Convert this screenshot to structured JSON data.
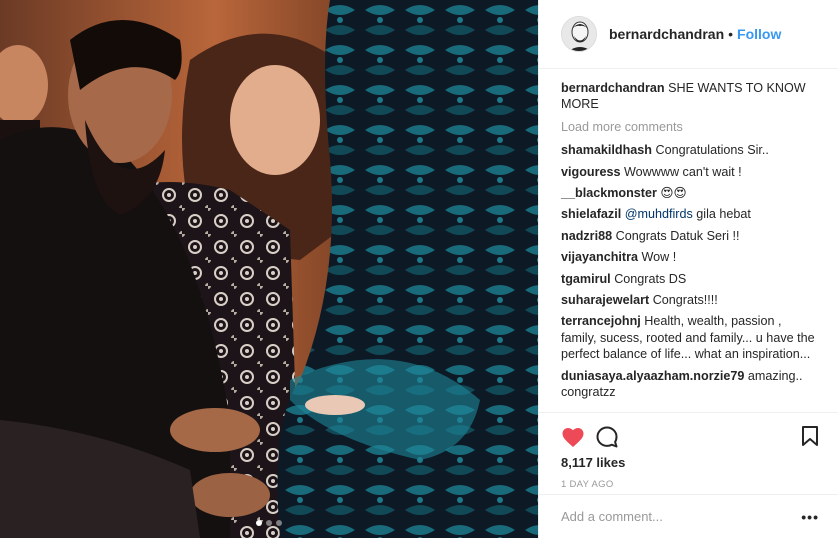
{
  "post": {
    "photo_label": "photo",
    "carousel": {
      "total": 3,
      "active": 0
    }
  },
  "header": {
    "username": "bernardchandran",
    "separator": "•",
    "follow_label": "Follow"
  },
  "caption": {
    "username": "bernardchandran",
    "text": "SHE WANTS TO KNOW MORE"
  },
  "load_more": "Load more comments",
  "comments": [
    {
      "username": "shamakildhash",
      "text": "Congratulations Sir.."
    },
    {
      "username": "vigouress",
      "text": "Wowwww can't wait !"
    },
    {
      "username": "__blackmonster",
      "text": "😍😍"
    },
    {
      "username": "shielafazil",
      "mention": "@muhdfirds",
      "text": "gila hebat"
    },
    {
      "username": "nadzri88",
      "text": "Congrats Datuk Seri !!"
    },
    {
      "username": "vijayanchitra",
      "text": "Wow !"
    },
    {
      "username": "tgamirul",
      "text": "Congrats DS"
    },
    {
      "username": "suharajewelart",
      "text": "Congrats!!!!"
    },
    {
      "username": "terrancejohnj",
      "text": "Health, wealth, passion , family, sucess, rooted and family... u have the perfect balance of life... what an inspiration..."
    },
    {
      "username": "duniasaya.alyaazham.norzie79",
      "text": "amazing.. congratzz"
    }
  ],
  "actions": {
    "like_icon": "heart-icon",
    "comment_icon": "comment-icon",
    "save_icon": "bookmark-icon",
    "liked": true,
    "like_color": "#ed4956"
  },
  "likes": "8,117 likes",
  "timestamp": "1 DAY AGO",
  "add_comment": {
    "placeholder": "Add a comment...",
    "more_label": "•••"
  },
  "colors": {
    "link": "#3897f0",
    "secondary_text": "#999999",
    "border": "#efefef"
  }
}
